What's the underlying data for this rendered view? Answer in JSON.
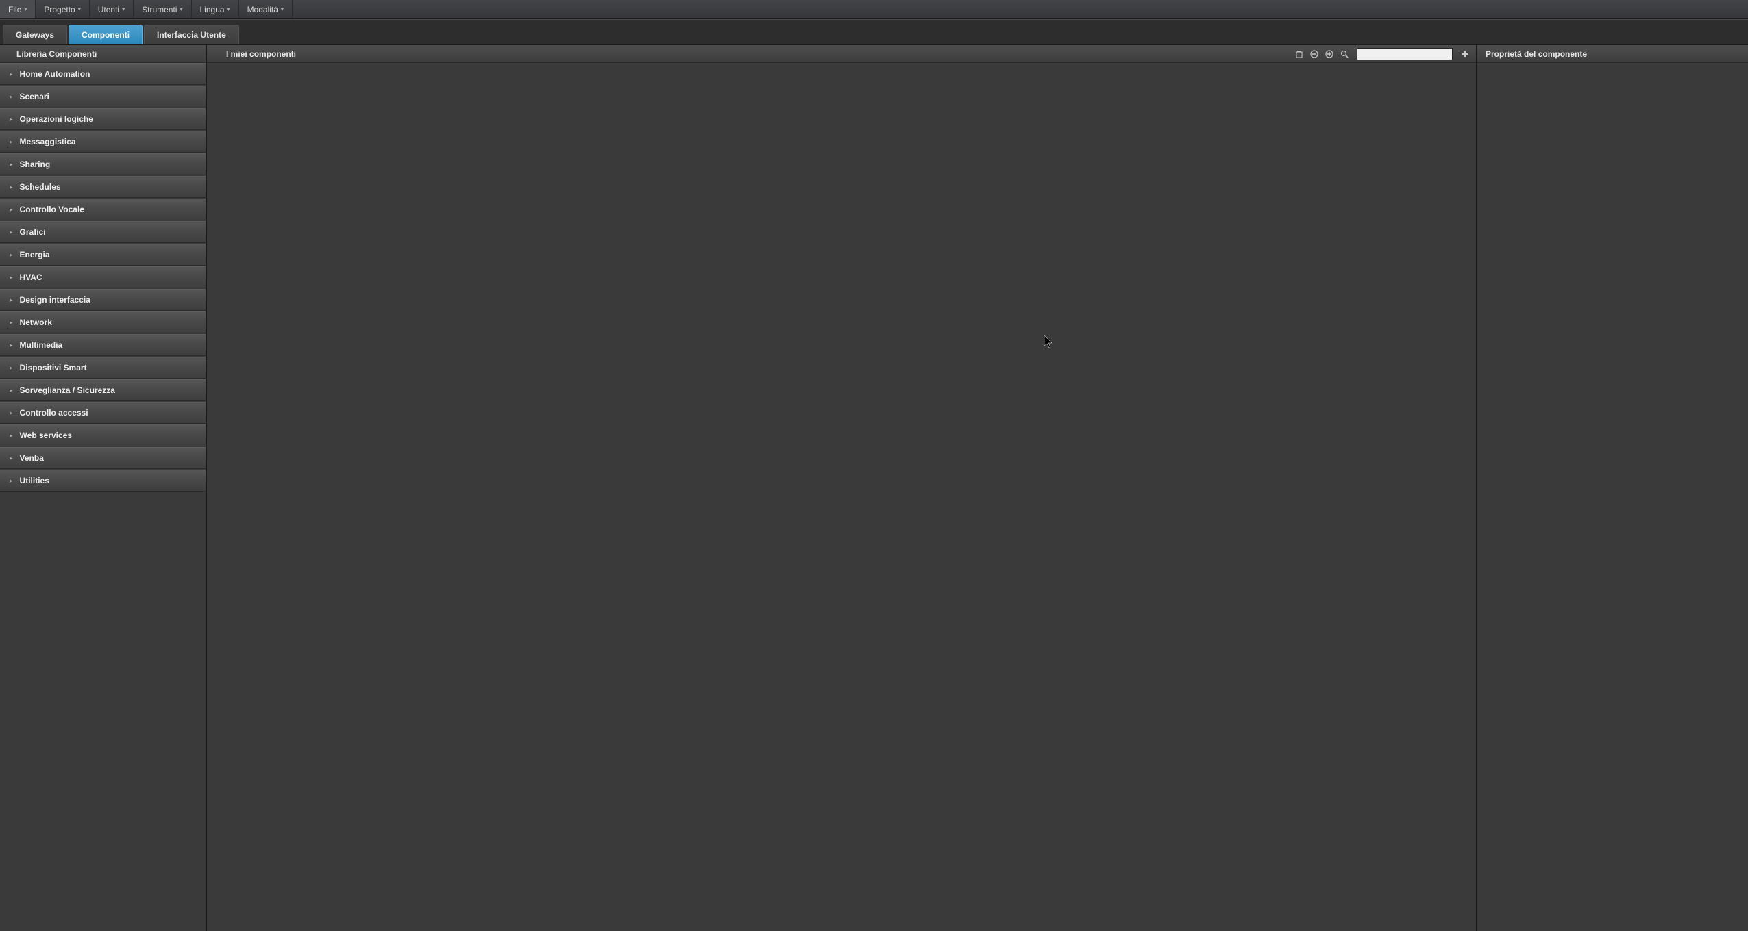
{
  "menubar": {
    "items": [
      "File",
      "Progetto",
      "Utenti",
      "Strumenti",
      "Lingua",
      "Modalità"
    ]
  },
  "tabs": {
    "items": [
      {
        "label": "Gateways",
        "active": false
      },
      {
        "label": "Componenti",
        "active": true
      },
      {
        "label": "Interfaccia Utente",
        "active": false
      }
    ]
  },
  "left_sidebar": {
    "title": "Libreria Componenti",
    "categories": [
      "Home Automation",
      "Scenari",
      "Operazioni logiche",
      "Messaggistica",
      "Sharing",
      "Schedules",
      "Controllo Vocale",
      "Grafici",
      "Energia",
      "HVAC",
      "Design interfaccia",
      "Network",
      "Multimedia",
      "Dispositivi Smart",
      "Sorveglianza / Sicurezza",
      "Controllo accessi",
      "Web services",
      "Venba",
      "Utilities"
    ]
  },
  "center_panel": {
    "title": "I miei componenti",
    "search_value": ""
  },
  "right_sidebar": {
    "title": "Proprietà del componente"
  }
}
